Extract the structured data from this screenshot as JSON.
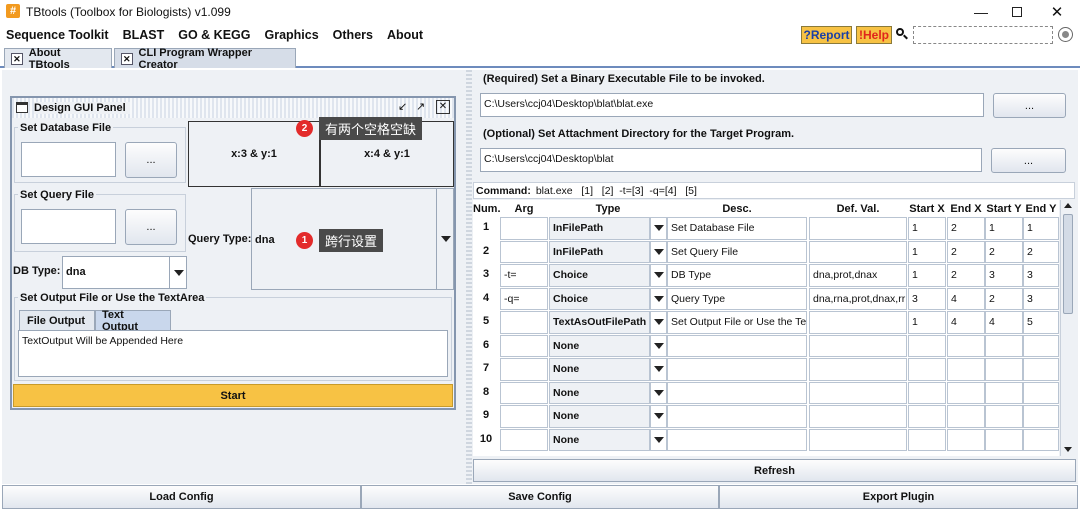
{
  "window": {
    "title": "TBtools (Toolbox for Biologists) v1.099"
  },
  "menu": {
    "items": [
      "Sequence Toolkit",
      "BLAST",
      "GO & KEGG",
      "Graphics",
      "Others",
      "About"
    ],
    "report_label": "?Report",
    "help_label": "!Help"
  },
  "tabs": [
    {
      "label": "About TBtools"
    },
    {
      "label": "CLI Program Wrapper Creator"
    }
  ],
  "design_panel": {
    "title": "Design GUI Panel",
    "set_db_label": "Set Database File",
    "set_query_label": "Set Query File",
    "browse_label": "...",
    "cell_a": "x:3 & y:1",
    "cell_b": "x:4 & y:1",
    "query_type_label": "Query Type:",
    "query_type_value": "dna",
    "db_type_label": "DB Type:",
    "db_type_value": "dna",
    "output_group_label": "Set Output File or Use the TextArea",
    "output_tabs": [
      "File Output",
      "Text Output"
    ],
    "output_text": "TextOutput Will be Appended Here",
    "start_label": "Start"
  },
  "annotations": [
    {
      "num": "2",
      "text": "有两个空格空缺"
    },
    {
      "num": "1",
      "text": "跨行设置"
    }
  ],
  "right_panel": {
    "required_label": "(Required) Set a Binary Executable File to be invoked.",
    "binary_path": "C:\\Users\\ccj04\\Desktop\\blat\\blat.exe",
    "optional_label": "(Optional) Set Attachment Directory for the Target Program.",
    "attach_path": "C:\\Users\\ccj04\\Desktop\\blat",
    "browse_label": "...",
    "command_label": "Command:",
    "command_value": "blat.exe   [1]   [2]  -t=[3]  -q=[4]   [5]",
    "refresh_label": "Refresh"
  },
  "table": {
    "headers": [
      "Num.",
      "Arg",
      "Type",
      "Desc.",
      "Def. Val.",
      "Start X",
      "End X",
      "Start Y",
      "End Y"
    ],
    "rows": [
      {
        "num": "1",
        "arg": "",
        "type": "InFilePath",
        "desc": "Set Database File",
        "def": "",
        "sx": "1",
        "ex": "2",
        "sy": "1",
        "ey": "1"
      },
      {
        "num": "2",
        "arg": "",
        "type": "InFilePath",
        "desc": "Set Query File",
        "def": "",
        "sx": "1",
        "ex": "2",
        "sy": "2",
        "ey": "2"
      },
      {
        "num": "3",
        "arg": "-t=",
        "type": "Choice",
        "desc": "DB Type",
        "def": "dna,prot,dnax",
        "sx": "1",
        "ex": "2",
        "sy": "3",
        "ey": "3"
      },
      {
        "num": "4",
        "arg": "-q=",
        "type": "Choice",
        "desc": "Query Type",
        "def": "dna,rna,prot,dnax,rr",
        "sx": "3",
        "ex": "4",
        "sy": "2",
        "ey": "3"
      },
      {
        "num": "5",
        "arg": "",
        "type": "TextAsOutFilePath",
        "desc": "Set Output File or Use the Te",
        "def": "",
        "sx": "1",
        "ex": "4",
        "sy": "4",
        "ey": "5"
      },
      {
        "num": "6",
        "arg": "",
        "type": "None",
        "desc": "",
        "def": "",
        "sx": "",
        "ex": "",
        "sy": "",
        "ey": ""
      },
      {
        "num": "7",
        "arg": "",
        "type": "None",
        "desc": "",
        "def": "",
        "sx": "",
        "ex": "",
        "sy": "",
        "ey": ""
      },
      {
        "num": "8",
        "arg": "",
        "type": "None",
        "desc": "",
        "def": "",
        "sx": "",
        "ex": "",
        "sy": "",
        "ey": ""
      },
      {
        "num": "9",
        "arg": "",
        "type": "None",
        "desc": "",
        "def": "",
        "sx": "",
        "ex": "",
        "sy": "",
        "ey": ""
      },
      {
        "num": "10",
        "arg": "",
        "type": "None",
        "desc": "",
        "def": "",
        "sx": "",
        "ex": "",
        "sy": "",
        "ey": ""
      }
    ]
  },
  "bottom": {
    "load_label": "Load Config",
    "save_label": "Save Config",
    "export_label": "Export Plugin"
  },
  "colors": {
    "accent_yellow": "#f7c244",
    "help_red": "#e0261b",
    "annotation_red": "#e32b2b",
    "annotation_bg": "#4a4a4a"
  }
}
